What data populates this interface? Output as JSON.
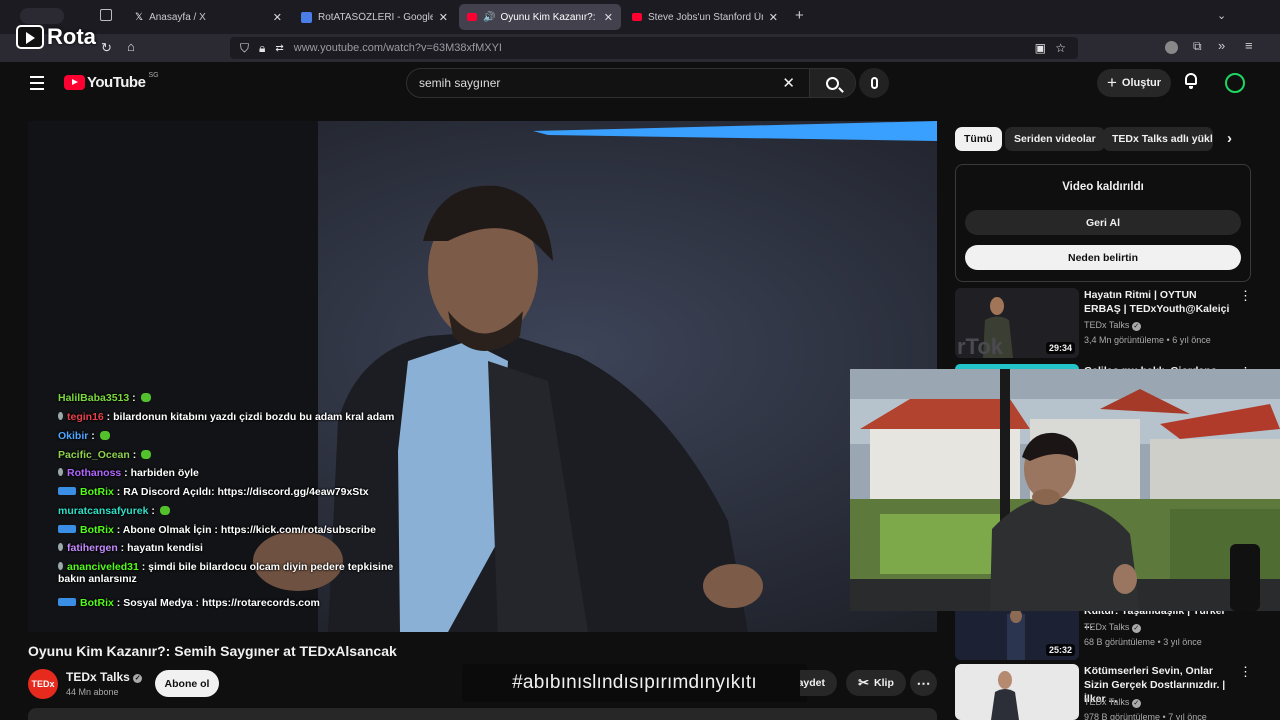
{
  "overlay_logo": {
    "text": "Rota"
  },
  "browser": {
    "tabs": [
      {
        "label": "Anasayfa / X",
        "icon": "x-logo-icon"
      },
      {
        "label": "RotATASÖZLERİ - Google Dokür",
        "icon": "google-docs-icon"
      },
      {
        "label": "Oyunu Kim Kazanır?: Semih",
        "icon": "youtube-icon"
      },
      {
        "label": "Steve Jobs'un Stanford Üniversi",
        "icon": "youtube-icon"
      }
    ],
    "url": "www.youtube.com/watch?v=63M38xfMXYI"
  },
  "youtube": {
    "logo": "YouTube",
    "region": "SG",
    "search_value": "semih saygıner",
    "create_label": "Oluştur"
  },
  "chat": [
    {
      "user": "HalilBaba3513",
      "text": "",
      "color": "#7bd93e"
    },
    {
      "user": "tegin16",
      "text": "bilardonun kitabını yazdı çizdi bozdu bu adam kral adam",
      "color": "#e8414b"
    },
    {
      "user": "Okibir",
      "text": "",
      "color": "#4fa6ff"
    },
    {
      "user": "Pacific_Ocean",
      "text": "",
      "color": "#8fd14f"
    },
    {
      "user": "Rothanoss",
      "text": "harbiden öyle",
      "color": "#b166ff"
    },
    {
      "user": "BotRix",
      "text": "RA Discord Açıldı: https://discord.gg/4eaw79xStx",
      "color": "#53fc18"
    },
    {
      "user": "muratcansafyurek",
      "text": "",
      "color": "#2ee0c8"
    },
    {
      "user": "BotRix",
      "text": "Abone Olmak İçin : https://kick.com/rota/subscribe",
      "color": "#53fc18"
    },
    {
      "user": "fatihergen",
      "text": "hayatın kendisi",
      "color": "#c58cff"
    },
    {
      "user": "ananciveled31",
      "text": "şimdi bile bilardocu olcam diyin pedere tepkisine",
      "text2": "bakın anlarsınız",
      "color": "#53fc18"
    },
    {
      "user": "BotRix",
      "text": "Sosyal Medya : https://rotarecords.com",
      "color": "#53fc18"
    }
  ],
  "chips": [
    "Tümü",
    "Seriden videolar",
    "TEDx Talks adlı yükle"
  ],
  "removed_card": {
    "title": "Video kaldırıldı",
    "undo": "Geri Al",
    "why": "Neden belirtin"
  },
  "recommendations": [
    {
      "title": "Hayatın Ritmi | OYTUN ERBAŞ | TEDxYouth@Kaleiçi",
      "channel": "TEDx Talks",
      "meta": "3,4 Mn görüntüleme • 6 yıl önce",
      "duration": "29:34"
    },
    {
      "title": "Galileo mu haklı, Giordano",
      "channel": "",
      "meta": "",
      "duration": ""
    },
    {
      "title": "Kültür: Yaşamdaşlık | Türker ...",
      "channel": "TEDx Talks",
      "meta": "68 B görüntüleme • 3 yıl önce",
      "duration": "25:32"
    },
    {
      "title": "Kötümserleri Sevin, Onlar Sizin Gerçek Dostlarınızdır. | İlker ...",
      "channel": "TEDx Talks",
      "meta": "978 B görüntüleme • 7 yıl önce",
      "duration": ""
    }
  ],
  "video": {
    "title": "Oyunu Kim Kazanır?: Semih Saygıner at TEDxAlsancak",
    "channel": "TEDx Talks",
    "subs": "44 Mn abone",
    "subscribe": "Abone ol",
    "save": "Kaydet",
    "clip": "Klip",
    "channel_avatar": "TEDx"
  },
  "hashtag_overlay": "#abıbınıslındısıpırımdınyıkıtı",
  "colors": {
    "youtube_red": "#ff0033",
    "ted_red": "#e62b1e",
    "avatar_green": "#1ed760"
  }
}
